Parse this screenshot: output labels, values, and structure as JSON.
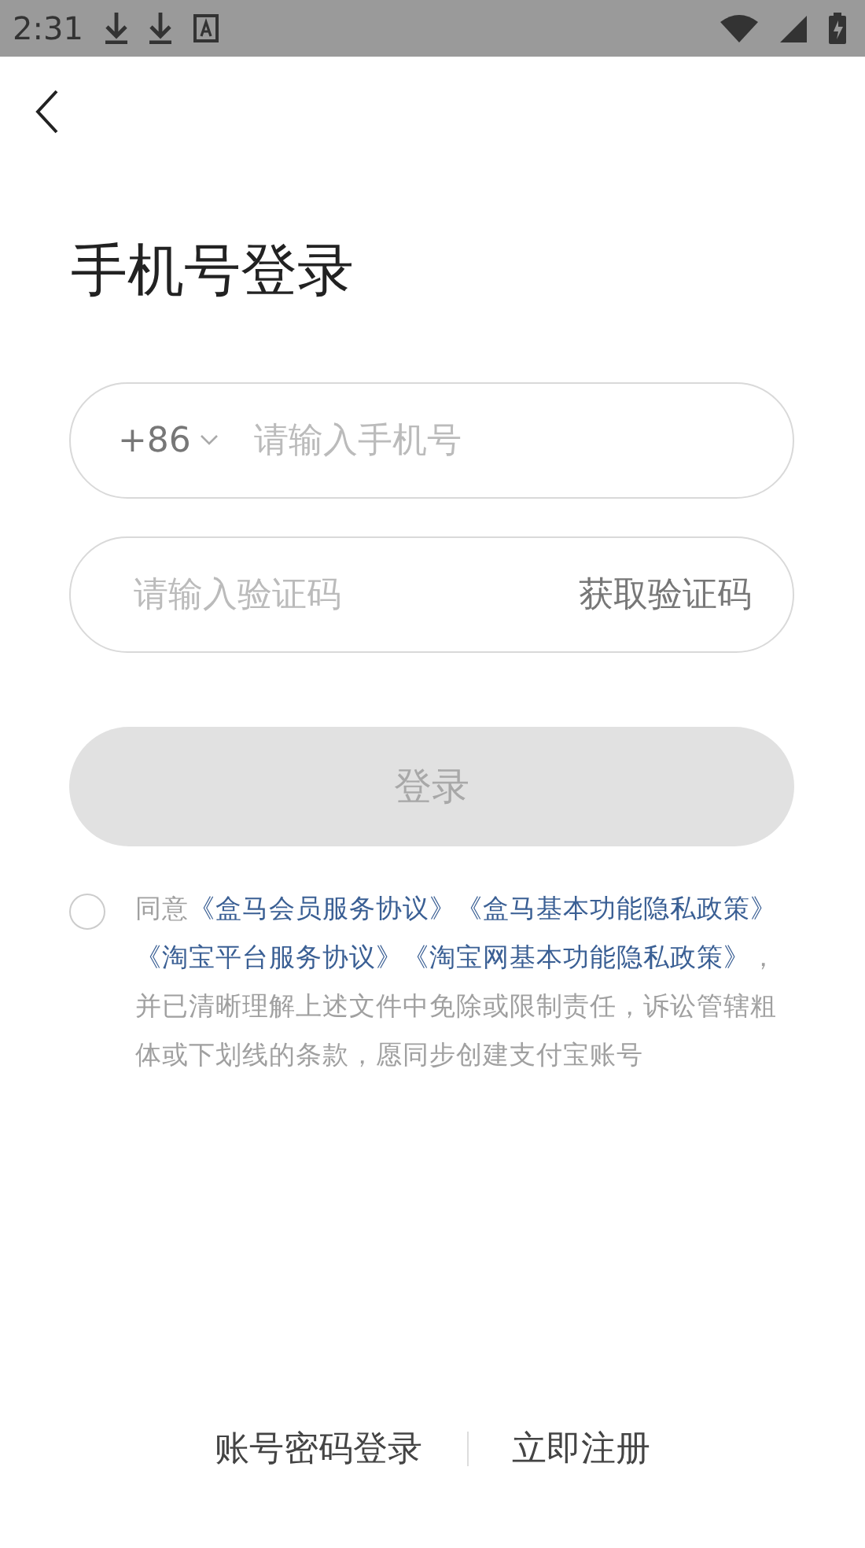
{
  "status_bar": {
    "time": "2:31"
  },
  "title": "手机号登录",
  "phone_field": {
    "country_code": "+86",
    "placeholder": "请输入手机号"
  },
  "code_field": {
    "placeholder": "请输入验证码",
    "action": "获取验证码"
  },
  "login_button": {
    "label": "登录",
    "disabled": true
  },
  "agreement": {
    "checked": false,
    "parts": [
      {
        "kind": "text",
        "text": "同意"
      },
      {
        "kind": "link",
        "text": "《盒马会员服务协议》"
      },
      {
        "kind": "link",
        "text": "《盒马基本功能隐私政策》"
      },
      {
        "kind": "link",
        "text": "《淘宝平台服务协议》"
      },
      {
        "kind": "link",
        "text": "《淘宝网基本功能隐私政策》"
      },
      {
        "kind": "text",
        "text": "，并已清晰理解上述文件中免除或限制责任，诉讼管辖粗体或下划线的条款，愿同步创建支付宝账号"
      }
    ]
  },
  "footer_links": [
    "账号密码登录",
    "立即注册"
  ]
}
